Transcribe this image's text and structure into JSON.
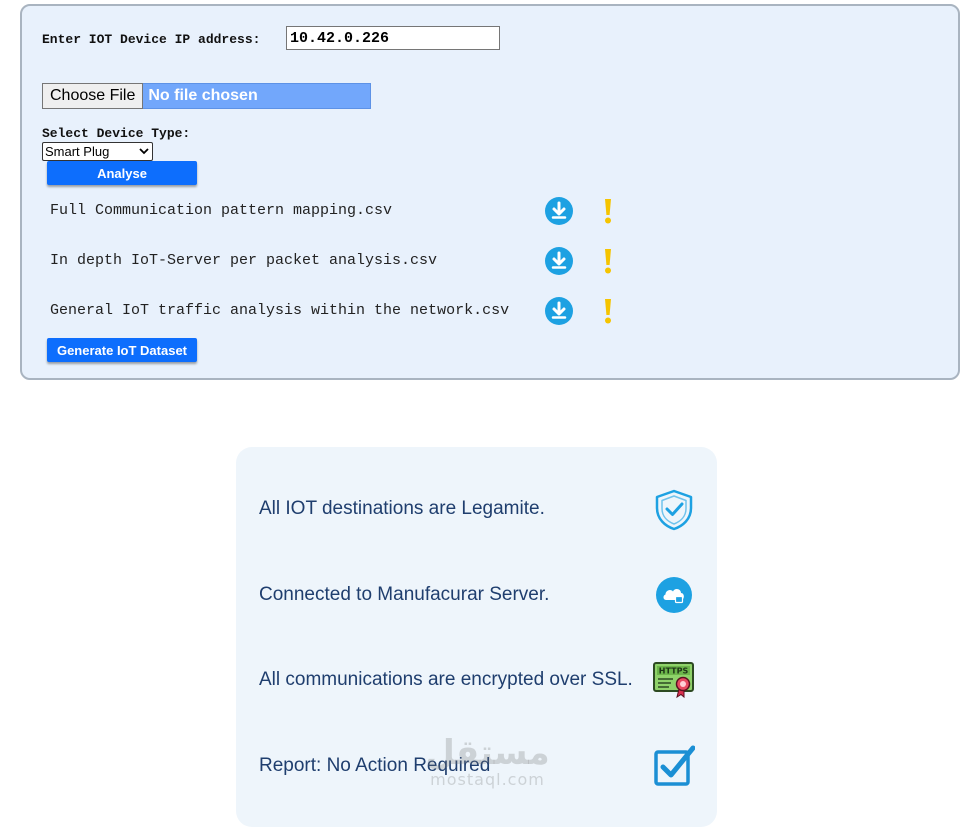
{
  "form": {
    "ip_label": "Enter IOT Device IP address:",
    "ip_value": "10.42.0.226",
    "file_button_label": "Choose File",
    "file_status": "No file chosen",
    "device_type_label": "Select Device Type:",
    "device_type_selected": "Smart Plug",
    "analyse_label": "Analyse",
    "generate_label": "Generate IoT Dataset",
    "files": [
      {
        "name": "Full Communication pattern mapping.csv",
        "icon": "download-icon",
        "status_icon": "exclamation-icon"
      },
      {
        "name": "In depth IoT-Server per packet analysis.csv",
        "icon": "download-icon",
        "status_icon": "exclamation-icon"
      },
      {
        "name": "General IoT traffic analysis within the network.csv",
        "icon": "download-icon",
        "status_icon": "exclamation-icon"
      }
    ]
  },
  "report": {
    "items": [
      {
        "text": "All IOT destinations are Legamite.",
        "icon": "shield-check-icon"
      },
      {
        "text": "Connected to Manufacurar Server.",
        "icon": "cloud-lock-icon"
      },
      {
        "text": "All communications are encrypted over SSL.",
        "icon": "https-certificate-icon"
      },
      {
        "text": "Report: No Action Required",
        "icon": "checkbox-checked-icon"
      }
    ]
  },
  "watermark": {
    "arabic": "مستقل",
    "latin": "mostaql.com"
  },
  "colors": {
    "panel_bg": "#e8f1fc",
    "button_blue": "#0d6efd",
    "file_bar": "#72a7fb",
    "report_text": "#1f3e6e",
    "icon_blue": "#1da1e2",
    "warning_yellow": "#f5c400"
  }
}
